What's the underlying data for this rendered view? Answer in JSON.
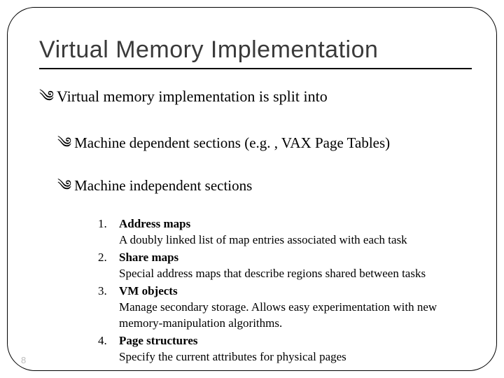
{
  "title": "Virtual Memory Implementation",
  "lvl1": "Virtual memory implementation is split into",
  "lvl2a": "Machine dependent sections (e.g. , VAX Page Tables)",
  "lvl2b": "Machine independent sections",
  "bullet_glyph": "༄",
  "items": [
    {
      "n": "1.",
      "title": "Address maps",
      "desc": "A doubly linked list of map entries associated with each task"
    },
    {
      "n": "2.",
      "title": "Share maps",
      "desc": "Special address maps that describe regions shared between tasks"
    },
    {
      "n": "3.",
      "title": "VM objects",
      "desc": "Manage secondary storage. Allows easy experimentation with new memory-manipulation algorithms."
    },
    {
      "n": "4.",
      "title": "Page structures",
      "desc": "Specify the current attributes for physical pages"
    }
  ],
  "page_number": "8"
}
